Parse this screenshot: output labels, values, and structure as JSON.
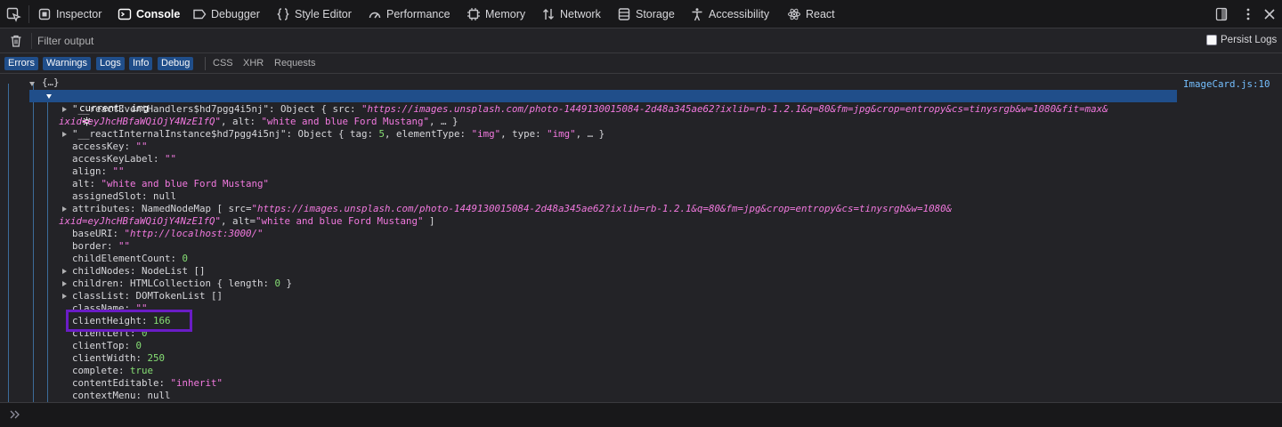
{
  "toolbar": {
    "picker_icon": "element-picker-icon",
    "tabs": [
      {
        "label": "Inspector",
        "icon": "inspector-icon"
      },
      {
        "label": "Console",
        "icon": "console-icon",
        "selected": true
      },
      {
        "label": "Debugger",
        "icon": "debugger-icon"
      },
      {
        "label": "Style Editor",
        "icon": "style-editor-icon"
      },
      {
        "label": "Performance",
        "icon": "performance-icon"
      },
      {
        "label": "Memory",
        "icon": "memory-icon"
      },
      {
        "label": "Network",
        "icon": "network-icon"
      },
      {
        "label": "Storage",
        "icon": "storage-icon"
      },
      {
        "label": "Accessibility",
        "icon": "accessibility-icon"
      },
      {
        "label": "React",
        "icon": "react-icon"
      }
    ]
  },
  "filter": {
    "placeholder": "Filter output",
    "persist_logs_label": "Persist Logs",
    "persist_logs_checked": false
  },
  "levels": [
    {
      "label": "Errors",
      "active": true
    },
    {
      "label": "Warnings",
      "active": true
    },
    {
      "label": "Logs",
      "active": true
    },
    {
      "label": "Info",
      "active": true
    },
    {
      "label": "Debug",
      "active": true
    },
    {
      "label": "CSS",
      "active": false
    },
    {
      "label": "XHR",
      "active": false
    },
    {
      "label": "Requests",
      "active": false
    }
  ],
  "console": {
    "source_link": "ImageCard.js:10",
    "root_label": "{…}",
    "selected_label": "current: img",
    "highlighted_property": "clientHeight",
    "colors": {
      "accent": "#204e8a",
      "highlight_box": "#6a1cc6",
      "string": "#f279df",
      "number": "#86de74"
    },
    "lines": [
      {
        "twisty": "closed",
        "indent": 1,
        "parts": [
          [
            "k",
            "\"__reactEventHandlers$hd7pgg4i5nj\": "
          ],
          [
            "p",
            "Object { src: "
          ],
          [
            "si",
            "\"https://images.unsplash.com/photo-1449130015084-2d48a345ae62?ixlib=rb-1.2.1&q=80&fm=jpg&crop=entropy&cs=tinysrgb&w=1080&fit=max&"
          ]
        ]
      },
      {
        "twisty": "none",
        "indent": 0,
        "parts": [
          [
            "si",
            "ixid=eyJhcHBfaWQiOjY4NzE1fQ\""
          ],
          [
            "p",
            ", alt: "
          ],
          [
            "s",
            "\"white and blue Ford Mustang\""
          ],
          [
            "p",
            ", … }"
          ]
        ]
      },
      {
        "twisty": "closed",
        "indent": 1,
        "parts": [
          [
            "k",
            "\"__reactInternalInstance$hd7pgg4i5nj\": "
          ],
          [
            "p",
            "Object { tag: "
          ],
          [
            "n",
            "5"
          ],
          [
            "p",
            ", elementType: "
          ],
          [
            "s",
            "\"img\""
          ],
          [
            "p",
            ", type: "
          ],
          [
            "s",
            "\"img\""
          ],
          [
            "p",
            ", … }"
          ]
        ]
      },
      {
        "twisty": "none",
        "indent": 1,
        "parts": [
          [
            "k",
            "accessKey: "
          ],
          [
            "s",
            "\"\""
          ]
        ]
      },
      {
        "twisty": "none",
        "indent": 1,
        "parts": [
          [
            "k",
            "accessKeyLabel: "
          ],
          [
            "s",
            "\"\""
          ]
        ]
      },
      {
        "twisty": "none",
        "indent": 1,
        "parts": [
          [
            "k",
            "align: "
          ],
          [
            "s",
            "\"\""
          ]
        ]
      },
      {
        "twisty": "none",
        "indent": 1,
        "parts": [
          [
            "k",
            "alt: "
          ],
          [
            "s",
            "\"white and blue Ford Mustang\""
          ]
        ]
      },
      {
        "twisty": "none",
        "indent": 1,
        "parts": [
          [
            "k",
            "assignedSlot: "
          ],
          [
            "p",
            "null"
          ]
        ]
      },
      {
        "twisty": "closed",
        "indent": 1,
        "parts": [
          [
            "k",
            "attributes: "
          ],
          [
            "p",
            "NamedNodeMap [ src="
          ],
          [
            "si",
            "\"https://images.unsplash.com/photo-1449130015084-2d48a345ae62?ixlib=rb-1.2.1&q=80&fm=jpg&crop=entropy&cs=tinysrgb&w=1080&"
          ]
        ]
      },
      {
        "twisty": "none",
        "indent": 0,
        "parts": [
          [
            "si",
            "ixid=eyJhcHBfaWQiOjY4NzE1fQ\""
          ],
          [
            "p",
            ", alt="
          ],
          [
            "s",
            "\"white and blue Ford Mustang\""
          ],
          [
            "p",
            " ]"
          ]
        ]
      },
      {
        "twisty": "none",
        "indent": 1,
        "parts": [
          [
            "k",
            "baseURI: "
          ],
          [
            "si",
            "\"http://localhost:3000/\""
          ]
        ]
      },
      {
        "twisty": "none",
        "indent": 1,
        "parts": [
          [
            "k",
            "border: "
          ],
          [
            "s",
            "\"\""
          ]
        ]
      },
      {
        "twisty": "none",
        "indent": 1,
        "parts": [
          [
            "k",
            "childElementCount: "
          ],
          [
            "n",
            "0"
          ]
        ]
      },
      {
        "twisty": "closed",
        "indent": 1,
        "parts": [
          [
            "k",
            "childNodes: "
          ],
          [
            "p",
            "NodeList []"
          ]
        ]
      },
      {
        "twisty": "closed",
        "indent": 1,
        "parts": [
          [
            "k",
            "children: "
          ],
          [
            "p",
            "HTMLCollection { length: "
          ],
          [
            "n",
            "0"
          ],
          [
            "p",
            " }"
          ]
        ]
      },
      {
        "twisty": "closed",
        "indent": 1,
        "parts": [
          [
            "k",
            "classList: "
          ],
          [
            "p",
            "DOMTokenList []"
          ]
        ]
      },
      {
        "twisty": "none",
        "indent": 1,
        "parts": [
          [
            "k",
            "className: "
          ],
          [
            "s",
            "\"\""
          ]
        ]
      },
      {
        "twisty": "none",
        "indent": 1,
        "parts": [
          [
            "k",
            "clientHeight: "
          ],
          [
            "n",
            "166"
          ]
        ]
      },
      {
        "twisty": "none",
        "indent": 1,
        "parts": [
          [
            "k",
            "clientLeft: "
          ],
          [
            "n",
            "0"
          ]
        ]
      },
      {
        "twisty": "none",
        "indent": 1,
        "parts": [
          [
            "k",
            "clientTop: "
          ],
          [
            "n",
            "0"
          ]
        ]
      },
      {
        "twisty": "none",
        "indent": 1,
        "parts": [
          [
            "k",
            "clientWidth: "
          ],
          [
            "n",
            "250"
          ]
        ]
      },
      {
        "twisty": "none",
        "indent": 1,
        "parts": [
          [
            "k",
            "complete: "
          ],
          [
            "kw",
            "true"
          ]
        ]
      },
      {
        "twisty": "none",
        "indent": 1,
        "parts": [
          [
            "k",
            "contentEditable: "
          ],
          [
            "s",
            "\"inherit\""
          ]
        ]
      },
      {
        "twisty": "none",
        "indent": 1,
        "parts": [
          [
            "k",
            "contextMenu: "
          ],
          [
            "p",
            "null"
          ]
        ]
      }
    ]
  }
}
